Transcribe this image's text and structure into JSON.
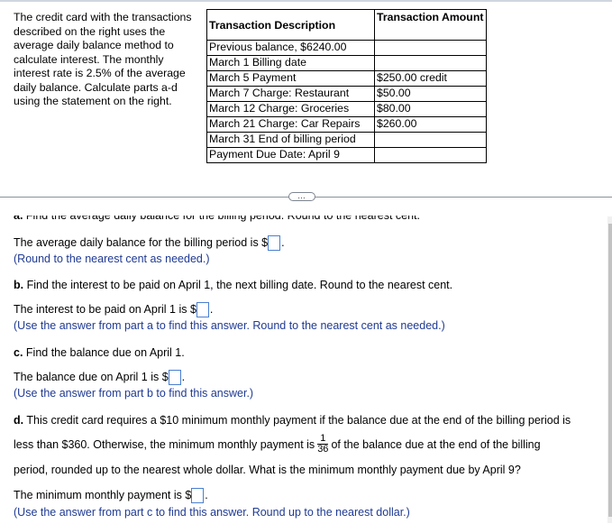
{
  "intro": "The credit card with the transactions described on the right uses the average daily balance method to calculate interest.  The monthly interest rate is 2.5% of the average daily balance.  Calculate parts a-d using the statement on the right.",
  "statement": {
    "headers": [
      "Transaction Description",
      "Transaction Amount"
    ],
    "rows": [
      {
        "description": "Previous balance, $6240.00",
        "amount": ""
      },
      {
        "description": "March 1 Billing date",
        "amount": ""
      },
      {
        "description": "March 5 Payment",
        "amount": "$250.00 credit"
      },
      {
        "description": "March 7 Charge: Restaurant",
        "amount": "$50.00"
      },
      {
        "description": "March 12 Charge: Groceries",
        "amount": "$80.00"
      },
      {
        "description": "March 21 Charge: Car Repairs",
        "amount": "$260.00"
      },
      {
        "description": "March 31 End of billing period",
        "amount": ""
      },
      {
        "description": "Payment Due Date: April 9",
        "amount": ""
      }
    ]
  },
  "more_button": "…",
  "parts": {
    "a": {
      "label": "a.",
      "question": " Find the average daily balance for the billing period.  Round to the nearest cent.",
      "answer_prefix": "The average daily balance for the billing period is $",
      "answer_value": "",
      "hint": "(Round to the nearest cent as needed.)"
    },
    "b": {
      "label": "b.",
      "question": " Find the interest to be paid on April 1, the next billing date.  Round to the nearest cent.",
      "answer_prefix": "The interest to be paid on April 1 is $",
      "answer_value": "",
      "hint": "(Use the answer from part a to find this answer. Round to the nearest cent as needed.)"
    },
    "c": {
      "label": "c.",
      "question": " Find the balance due on April 1.",
      "answer_prefix": "The balance due on April 1 is $",
      "answer_value": "",
      "hint": "(Use the answer from part b to find this answer.)"
    },
    "d": {
      "label": "d.",
      "question_line1": " This credit card requires a $10 minimum monthly payment if the balance due at the end of the billing period is",
      "question_line2_pre": "less than $360.  Otherwise, the minimum monthly payment is",
      "fraction_num": "1",
      "fraction_den": "36",
      "question_line2_post": "of the balance due at the end of the billing",
      "question_line3": "period, rounded up to the nearest whole dollar.  What is the minimum monthly payment due by April 9?",
      "answer_prefix": "The minimum monthly payment is $",
      "answer_value": "",
      "hint": "(Use the answer from part c to find this answer. Round up to the nearest dollar.)"
    }
  },
  "answer_suffix": "."
}
